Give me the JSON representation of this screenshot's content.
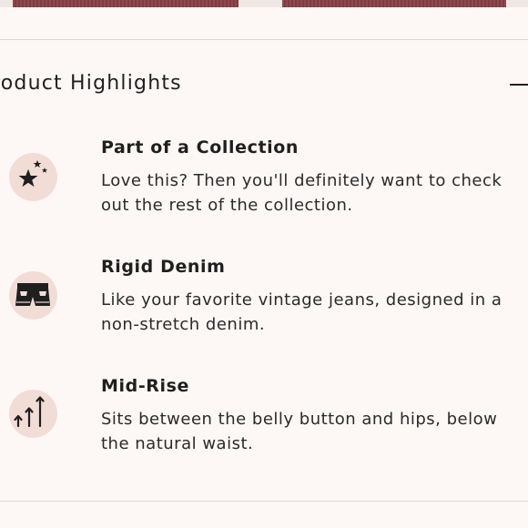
{
  "header": {
    "title": "roduct Highlights",
    "toggle_icon": "minus-icon"
  },
  "highlights": [
    {
      "icon": "stars-icon",
      "title": "Part of a Collection",
      "description": "Love this? Then you'll definitely want to check out the rest of the collection."
    },
    {
      "icon": "denim-shorts-icon",
      "title": "Rigid Denim",
      "description": "Like your favorite vintage jeans, designed in a non-stretch denim."
    },
    {
      "icon": "rise-arrows-icon",
      "title": "Mid-Rise",
      "description": "Sits between the belly button and hips, below the natural waist."
    }
  ],
  "colors": {
    "background": "#fdf8f6",
    "icon_blob": "#f2ddd6",
    "text": "#222222",
    "divider": "#dcd6d2",
    "product_image": "#8f4a4e"
  }
}
